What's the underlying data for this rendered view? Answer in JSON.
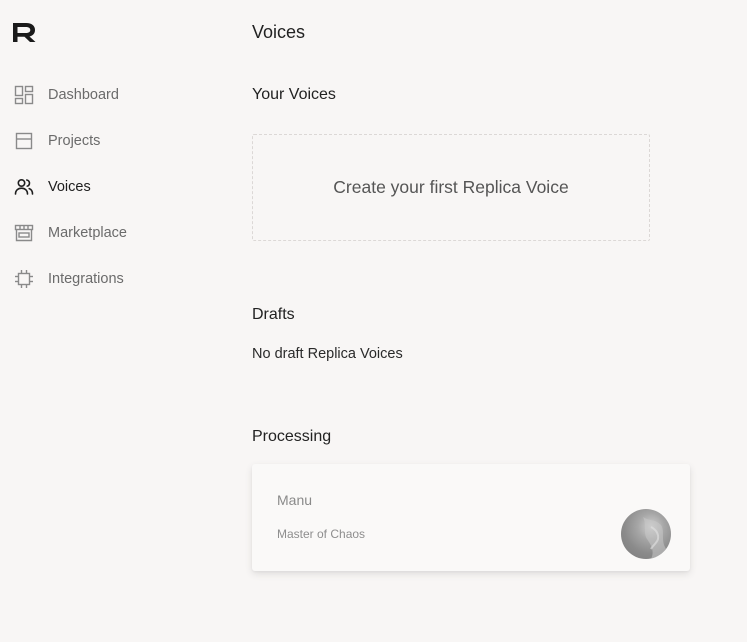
{
  "app": {
    "logo_icon": "replica-r-logo"
  },
  "sidebar": {
    "items": [
      {
        "label": "Dashboard",
        "icon": "dashboard-grid-icon",
        "active": false
      },
      {
        "label": "Projects",
        "icon": "projects-panel-icon",
        "active": false
      },
      {
        "label": "Voices",
        "icon": "users-icon",
        "active": true
      },
      {
        "label": "Marketplace",
        "icon": "storefront-icon",
        "active": false
      },
      {
        "label": "Integrations",
        "icon": "chip-icon",
        "active": false
      }
    ]
  },
  "main": {
    "title": "Voices",
    "your_voices": {
      "heading": "Your Voices",
      "create_label": "Create your first Replica Voice"
    },
    "drafts": {
      "heading": "Drafts",
      "empty_text": "No draft Replica Voices"
    },
    "processing": {
      "heading": "Processing",
      "cards": [
        {
          "name": "Manu",
          "description": "Master of Chaos"
        }
      ]
    }
  },
  "colors": {
    "background": "#f8f6f5",
    "text_primary": "#222222",
    "text_muted": "#6b6b6b",
    "dashed_border": "#dcd8d6"
  }
}
